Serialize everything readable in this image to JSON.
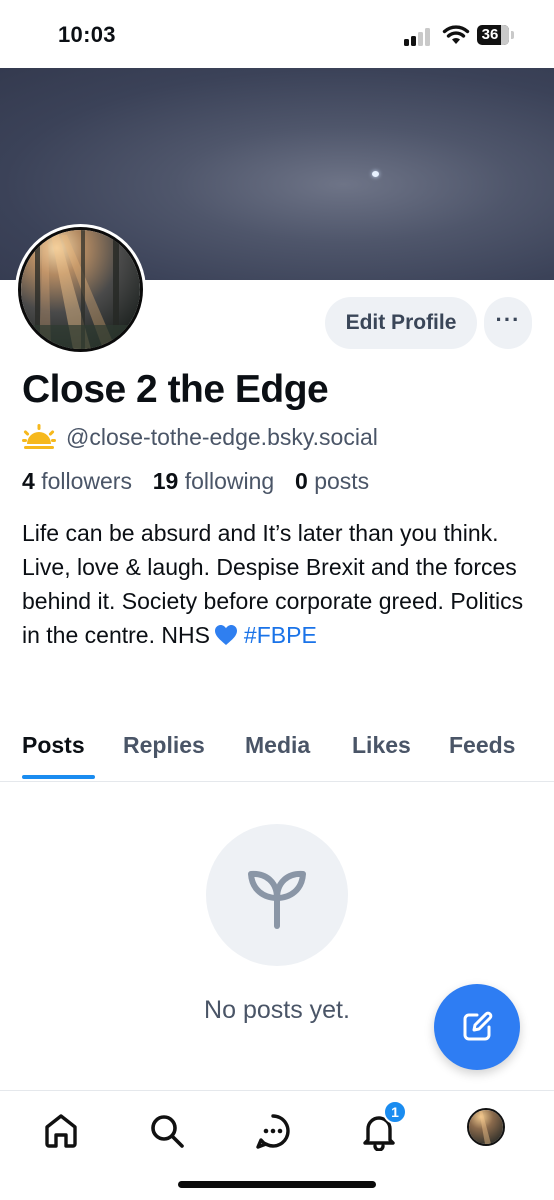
{
  "status_bar": {
    "time": "10:03",
    "battery": "36"
  },
  "profile": {
    "display_name": "Close 2 the Edge",
    "handle": "@close-tothe-edge.bsky.social",
    "edit_label": "Edit Profile",
    "more_label": "···",
    "stats": {
      "followers_count": "4",
      "followers_label": "followers",
      "following_count": "19",
      "following_label": "following",
      "posts_count": "0",
      "posts_label": "posts"
    },
    "bio": {
      "text": "Life can be absurd and It’s later than you think. Live, love & laugh. Despise Brexit and the forces behind it. Society before corporate greed. Politics in the centre. NHS",
      "hashtag": "#FBPE"
    }
  },
  "tabs": [
    {
      "label": "Posts",
      "active": true
    },
    {
      "label": "Replies",
      "active": false
    },
    {
      "label": "Media",
      "active": false
    },
    {
      "label": "Likes",
      "active": false
    },
    {
      "label": "Feeds",
      "active": false
    }
  ],
  "empty_state": {
    "icon": "sprout-icon",
    "text": "No posts yet."
  },
  "fab": {
    "icon": "compose-icon"
  },
  "bottom_nav": {
    "items": [
      "home-icon",
      "search-icon",
      "chat-icon",
      "bell-icon",
      "profile-avatar"
    ],
    "notification_badge": "1"
  },
  "colors": {
    "accent": "#1a8cf0",
    "fab": "#2e7df3",
    "muted_text": "#4a5567",
    "pill_bg": "#eef1f5"
  }
}
